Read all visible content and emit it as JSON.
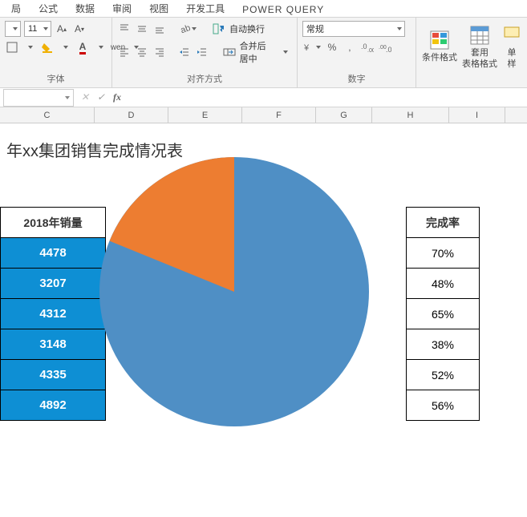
{
  "tabs": {
    "t1": "局",
    "t2": "公式",
    "t3": "数据",
    "t4": "审阅",
    "t5": "视图",
    "t6": "开发工具",
    "t7": "POWER QUERY"
  },
  "ribbon": {
    "font_size": "11",
    "wen": "wen",
    "align_group": "对齐方式",
    "font_group": "字体",
    "num_group": "数字",
    "wrap": "自动换行",
    "merge": "合并后居中",
    "num_format": "常规",
    "pct": "%",
    "comma": ",",
    "cond": "条件格式",
    "cond2": "",
    "tblfmt": "套用",
    "tblfmt2": "表格格式",
    "cell": "单",
    "cell2": "样"
  },
  "fbar": {
    "name": "",
    "cancel": "✕",
    "ok": "✓",
    "fx": "fx"
  },
  "cols": {
    "c": "C",
    "d": "D",
    "e": "E",
    "f": "F",
    "g": "G",
    "h": "H",
    "i": "I"
  },
  "title": "年xx集团销售完成情况表",
  "sales": {
    "hdr": "2018年销量",
    "r1": "4478",
    "r2": "3207",
    "r3": "4312",
    "r4": "3148",
    "r5": "4335",
    "r6": "4892"
  },
  "rate": {
    "hdr": "完成率",
    "r1": "70%",
    "r2": "48%",
    "r3": "65%",
    "r4": "38%",
    "r5": "52%",
    "r6": "56%"
  },
  "chart_data": {
    "type": "pie",
    "title": "",
    "series": [
      {
        "name": "",
        "values": [
          77,
          23
        ],
        "colors": [
          "#4f8fc5",
          "#ed7d31"
        ]
      }
    ],
    "note": "Pie overlays spreadsheet; two slices visible, approx 77% blue / 23% orange. Underlying table shows 2018年销量 values [4478,3207,4312,3148,4335,4892] and 完成率 [70%,48%,65%,38%,52%,56%]."
  }
}
